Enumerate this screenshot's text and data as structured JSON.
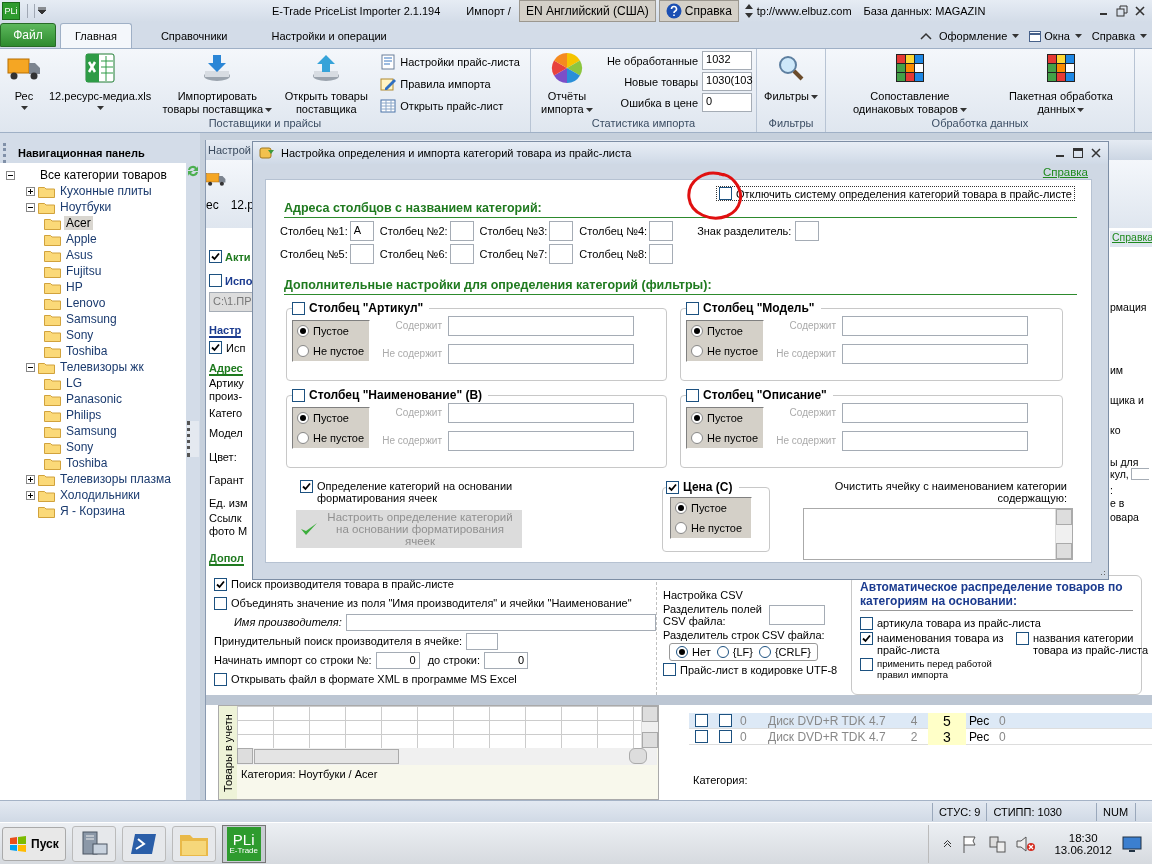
{
  "window": {
    "app_icon": "PLi",
    "title": "E-Trade PriceList Importer 2.1.194",
    "title_fragment": "Импорт /",
    "language": "EN Английский (США)",
    "help": "Справка",
    "url_fragment": "tp://www.elbuz.com",
    "database": "База данных: MAGAZIN"
  },
  "ribbon_tabs": [
    {
      "label": "Файл",
      "kind": "file",
      "selected": false
    },
    {
      "label": "Главная",
      "kind": "tab",
      "selected": true
    },
    {
      "label": "Справочники",
      "kind": "tab",
      "selected": false
    },
    {
      "label": "Настройки и операции",
      "kind": "tab",
      "selected": false
    }
  ],
  "ribbon_menus": [
    "Оформление",
    "Окна",
    "Справка"
  ],
  "ribbon_groups": [
    {
      "title": "Поставщики и прайсы",
      "items": [
        {
          "kind": "large",
          "label": "Рес",
          "dropdown": true
        },
        {
          "kind": "large",
          "label": "12.ресурс-медиа.xls",
          "dropdown": true
        },
        {
          "kind": "large",
          "label": "Импортировать товары поставщика",
          "dropdown": true
        },
        {
          "kind": "large",
          "label": "Открыть товары поставщика",
          "dropdown": false
        },
        {
          "kind": "small_stack",
          "entries": [
            "Настройки прайс-листа",
            "Правила импорта",
            "Открыть прайс-лист"
          ]
        }
      ]
    },
    {
      "title": "Статистика импорта",
      "items": [
        {
          "kind": "large",
          "label": "Отчёты импорта",
          "dropdown": true
        },
        {
          "kind": "stats",
          "entries": [
            {
              "label": "Не обработанные",
              "value": "1032"
            },
            {
              "label": "Новые товары",
              "value": "1030(103"
            },
            {
              "label": "Ошибка в цене",
              "value": "0"
            }
          ]
        }
      ]
    },
    {
      "title": "Фильтры",
      "items": [
        {
          "kind": "large",
          "label": "Фильтры",
          "dropdown": true
        }
      ]
    },
    {
      "title": "Обработка данных",
      "items": [
        {
          "kind": "large",
          "label": "Сопоставление одинаковых товаров",
          "dropdown": true
        },
        {
          "kind": "large",
          "label": "Пакетная обработка данных",
          "dropdown": true
        }
      ]
    }
  ],
  "nav": {
    "title": "Навигационная панель",
    "tree": [
      {
        "label": "Все категории товаров",
        "expanded": true,
        "selected": false,
        "children": [
          {
            "label": "Кухонные плиты",
            "expanded": false,
            "selected": false
          },
          {
            "label": "Ноутбуки",
            "expanded": true,
            "selected": false,
            "children": [
              {
                "label": "Acer",
                "selected": true
              },
              {
                "label": "Apple",
                "selected": false
              },
              {
                "label": "Asus",
                "selected": false
              },
              {
                "label": "Fujitsu",
                "selected": false
              },
              {
                "label": "HP",
                "selected": false
              },
              {
                "label": "Lenovo",
                "selected": false
              },
              {
                "label": "Samsung",
                "selected": false
              },
              {
                "label": "Sony",
                "selected": false
              },
              {
                "label": "Toshiba",
                "selected": false
              }
            ]
          },
          {
            "label": "Телевизоры жк",
            "expanded": true,
            "selected": false,
            "children": [
              {
                "label": "LG",
                "selected": false
              },
              {
                "label": "Panasonic",
                "selected": false
              },
              {
                "label": "Philips",
                "selected": false
              },
              {
                "label": "Samsung",
                "selected": false
              },
              {
                "label": "Sony",
                "selected": false
              },
              {
                "label": "Toshiba",
                "selected": false
              }
            ]
          },
          {
            "label": "Телевизоры плазма",
            "expanded": false,
            "selected": false
          },
          {
            "label": "Холодильники",
            "expanded": false,
            "selected": false
          },
          {
            "label": "Я - Корзина",
            "selected": false
          }
        ]
      }
    ]
  },
  "workspace": {
    "child_title": "Настрой",
    "child_ribbon": [
      "ес",
      "12.р"
    ],
    "help_link": "Справка",
    "left_fragments": [
      {
        "kind": "checkbox",
        "label": "Акти",
        "checked": true,
        "color": "#1f7a1f"
      },
      {
        "kind": "checkbox",
        "label": "Испо",
        "checked": false,
        "color": "#1b3b8f"
      },
      {
        "kind": "field",
        "label": "C:\\1.ПР"
      },
      {
        "kind": "heading",
        "label": "Настр",
        "color": "#1b3b8f"
      },
      {
        "kind": "checkbox",
        "label": "Исп",
        "checked": true
      },
      {
        "kind": "heading",
        "label": "Адрес",
        "color": "#1f7a1f"
      },
      {
        "kind": "text",
        "label": "Артику"
      },
      {
        "kind": "text",
        "label": "произ-"
      },
      {
        "kind": "text",
        "label": "Катего"
      },
      {
        "kind": "text",
        "label": "Модел"
      },
      {
        "kind": "text",
        "label": "Цвет:"
      },
      {
        "kind": "text",
        "label": "Гарант"
      },
      {
        "kind": "text",
        "label": "Ед. изм"
      },
      {
        "kind": "text",
        "label": "Ссылк"
      },
      {
        "kind": "text",
        "label": "фото М"
      },
      {
        "kind": "heading",
        "label": "Допол",
        "color": "#1f7a1f"
      }
    ],
    "right_fragments": [
      {
        "kind": "text",
        "label": "рмация"
      },
      {
        "kind": "text",
        "label": "им"
      },
      {
        "kind": "text",
        "label": "щика и"
      },
      {
        "kind": "text",
        "label": "ко"
      },
      {
        "kind": "text",
        "label": "ы для"
      },
      {
        "kind": "text_with_field",
        "label": "кул,"
      },
      {
        "kind": "text",
        "label": ":"
      },
      {
        "kind": "text",
        "label": "е в"
      },
      {
        "kind": "text",
        "label": "овара"
      }
    ],
    "import_options": [
      {
        "kind": "checkbox",
        "label": "Поиск производителя товара в прайс-листе",
        "checked": true
      },
      {
        "kind": "checkbox",
        "label": "Объединять значение из поля \"Имя производителя\" и ячейки \"Наименование\"",
        "checked": false
      },
      {
        "kind": "italic_field",
        "label": "Имя производителя:"
      },
      {
        "kind": "field",
        "label": "Принудительный поиск производителя в ячейке:"
      },
      {
        "kind": "range",
        "label": "Начинать импорт со строки №:",
        "value": "0",
        "label_to": "до строки:",
        "value_to": "0"
      },
      {
        "kind": "checkbox",
        "label": "Открывать файл в формате XML в программе MS Excel",
        "checked": false
      }
    ],
    "csv": {
      "heading": "Настройка CSV",
      "field_separator_label": "Разделитель полей CSV файла:",
      "row_separator_label": "Разделитель строк CSV файла:",
      "row_separators": [
        {
          "label": "Нет",
          "selected": true
        },
        {
          "label": "{LF}",
          "selected": false
        },
        {
          "label": "{CRLF}",
          "selected": false
        }
      ],
      "utf8": {
        "label": "Прайс-лист в кодировке UTF-8",
        "checked": false
      }
    },
    "auto": {
      "heading": "Автоматическое распределение товаров по категориям на основании:",
      "options": [
        {
          "label": "артикула товара из прайс-листа",
          "checked": false
        },
        {
          "label": "наименования товара из прайс-листа",
          "checked": true
        },
        {
          "label": "названия  категории товара из прайс-листа",
          "checked": false
        },
        {
          "label": "применить перед работой правил импорта",
          "checked": false
        }
      ]
    },
    "left_grid": {
      "side_label": "Товары в учетн",
      "category": "Категория: Ноутбуки / Acer"
    },
    "right_grid": {
      "rows": [
        {
          "selected": true,
          "checks": [
            false,
            false
          ],
          "cells": [
            "0",
            "Диск DVD+R TDK 4.7",
            "4",
            "5",
            "Рес",
            "0"
          ]
        },
        {
          "selected": false,
          "checks": [
            false,
            false
          ],
          "cells": [
            "0",
            "Диск DVD+R TDK 4.7",
            "2",
            "3",
            "Рес",
            "0"
          ]
        }
      ],
      "category": "Категория:"
    }
  },
  "dialog": {
    "title": "Настройка определения и импорта категорий товара из прайс-листа",
    "help_link": "Справка",
    "disable_option": {
      "label": "Отключить систему определения категорий товара в прайс-листе",
      "checked": false
    },
    "columns_heading": "Адреса столбцов с названием категорий:",
    "columns": [
      {
        "label": "Столбец №1:",
        "value": "A"
      },
      {
        "label": "Столбец №2:"
      },
      {
        "label": "Столбец №3:"
      },
      {
        "label": "Столбец №4:"
      },
      {
        "label": "Столбец №5:"
      },
      {
        "label": "Столбец №6:"
      },
      {
        "label": "Столбец №7:"
      },
      {
        "label": "Столбец №8:"
      }
    ],
    "separator_label": "Знак разделитель:",
    "filters_heading": "Дополнительные настройки для определения категорий (фильтры):",
    "filters": [
      {
        "title": "Столбец \"Артикул\"",
        "checked": false,
        "options": [
          {
            "label": "Пустое",
            "selected": true
          },
          {
            "label": "Не пустое",
            "selected": false
          }
        ],
        "contains_label": "Содержит",
        "not_contains_label": "Не содержит"
      },
      {
        "title": "Столбец \"Модель\"",
        "checked": false,
        "options": [
          {
            "label": "Пустое",
            "selected": true
          },
          {
            "label": "Не пустое",
            "selected": false
          }
        ],
        "contains_label": "Содержит",
        "not_contains_label": "Не содержит"
      },
      {
        "title": "Столбец \"Наименование\" (B)",
        "checked": false,
        "options": [
          {
            "label": "Пустое",
            "selected": true
          },
          {
            "label": "Не пустое",
            "selected": false
          }
        ],
        "contains_label": "Содержит",
        "not_contains_label": "Не содержит"
      },
      {
        "title": "Столбец \"Описание\"",
        "checked": false,
        "options": [
          {
            "label": "Пустое",
            "selected": true
          },
          {
            "label": "Не пустое",
            "selected": false
          }
        ],
        "contains_label": "Содержит",
        "not_contains_label": "Не содержит"
      }
    ],
    "format_option": {
      "label": "Определение категорий на основании форматирования ячеек",
      "checked": true
    },
    "format_button": {
      "label": "Настроить определение категорий на основании форматирования ячеек",
      "disabled": true
    },
    "price_filter": {
      "title": "Цена (С)",
      "checked": true,
      "options": [
        {
          "label": "Пустое",
          "selected": true
        },
        {
          "label": "Не пустое",
          "selected": false
        }
      ]
    },
    "clear_label": "Очистить ячейку с наименованием категории содержащую:"
  },
  "status_bar": [
    "СТУС: 9",
    "СТИПП: 1030",
    "NUM"
  ],
  "taskbar": {
    "start": "Пуск",
    "app_logo": "PLi",
    "app_caption": "E-Trade",
    "time": "18:30",
    "date": "13.06.2012"
  }
}
